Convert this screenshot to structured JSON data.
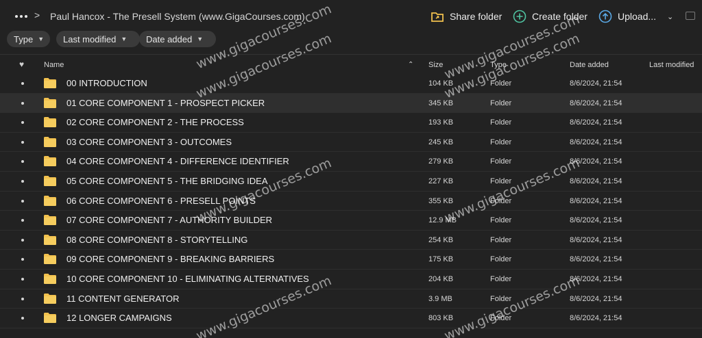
{
  "breadcrumb": {
    "separator": ">",
    "title": "Paul Hancox - The Presell System (www.GigaCourses.com)"
  },
  "toolbar": {
    "share_label": "Share folder",
    "create_label": "Create folder",
    "upload_label": "Upload..."
  },
  "filters": [
    {
      "label": "Type"
    },
    {
      "label": "Last modified"
    },
    {
      "label": "Date added"
    }
  ],
  "columns": {
    "name": "Name",
    "size": "Size",
    "type": "Type",
    "date_added": "Date added",
    "last_modified": "Last modified"
  },
  "rows": [
    {
      "name": "00 INTRODUCTION",
      "size": "104 KB",
      "type": "Folder",
      "date": "8/6/2024, 21:54"
    },
    {
      "name": "01 CORE COMPONENT 1 - PROSPECT PICKER",
      "size": "345 KB",
      "type": "Folder",
      "date": "8/6/2024, 21:54"
    },
    {
      "name": "02 CORE COMPONENT 2 - THE PROCESS",
      "size": "193 KB",
      "type": "Folder",
      "date": "8/6/2024, 21:54"
    },
    {
      "name": "03 CORE COMPONENT 3 - OUTCOMES",
      "size": "245 KB",
      "type": "Folder",
      "date": "8/6/2024, 21:54"
    },
    {
      "name": "04 CORE COMPONENT 4 - DIFFERENCE IDENTIFIER",
      "size": "279 KB",
      "type": "Folder",
      "date": "8/6/2024, 21:54"
    },
    {
      "name": "05 CORE COMPONENT 5 - THE BRIDGING IDEA",
      "size": "227 KB",
      "type": "Folder",
      "date": "8/6/2024, 21:54"
    },
    {
      "name": "06 CORE COMPONENT 6 - PRESELL POINTS",
      "size": "355 KB",
      "type": "Folder",
      "date": "8/6/2024, 21:54"
    },
    {
      "name": "07 CORE COMPONENT 7 - AUTHORITY BUILDER",
      "size": "12.9 MB",
      "type": "Folder",
      "date": "8/6/2024, 21:54"
    },
    {
      "name": "08 CORE COMPONENT 8 - STORYTELLING",
      "size": "254 KB",
      "type": "Folder",
      "date": "8/6/2024, 21:54"
    },
    {
      "name": "09 CORE COMPONENT 9 - BREAKING BARRIERS",
      "size": "175 KB",
      "type": "Folder",
      "date": "8/6/2024, 21:54"
    },
    {
      "name": "10 CORE COMPONENT 10 - ELIMINATING ALTERNATIVES",
      "size": "204 KB",
      "type": "Folder",
      "date": "8/6/2024, 21:54"
    },
    {
      "name": "11 CONTENT GENERATOR",
      "size": "3.9 MB",
      "type": "Folder",
      "date": "8/6/2024, 21:54"
    },
    {
      "name": "12 LONGER CAMPAIGNS",
      "size": "803 KB",
      "type": "Folder",
      "date": "8/6/2024, 21:54"
    }
  ],
  "watermark": "www.gigacourses.com",
  "colors": {
    "background": "#222222",
    "folder": "#f2c14e",
    "create_icon": "#4fc3a1",
    "upload_icon": "#5aa9e6",
    "share_icon": "#f2c14e"
  },
  "icons": [
    "more-icon",
    "share-folder-icon",
    "create-folder-icon",
    "upload-icon",
    "heart-icon",
    "folder-icon",
    "sort-up-icon",
    "chevron-down-icon"
  ]
}
